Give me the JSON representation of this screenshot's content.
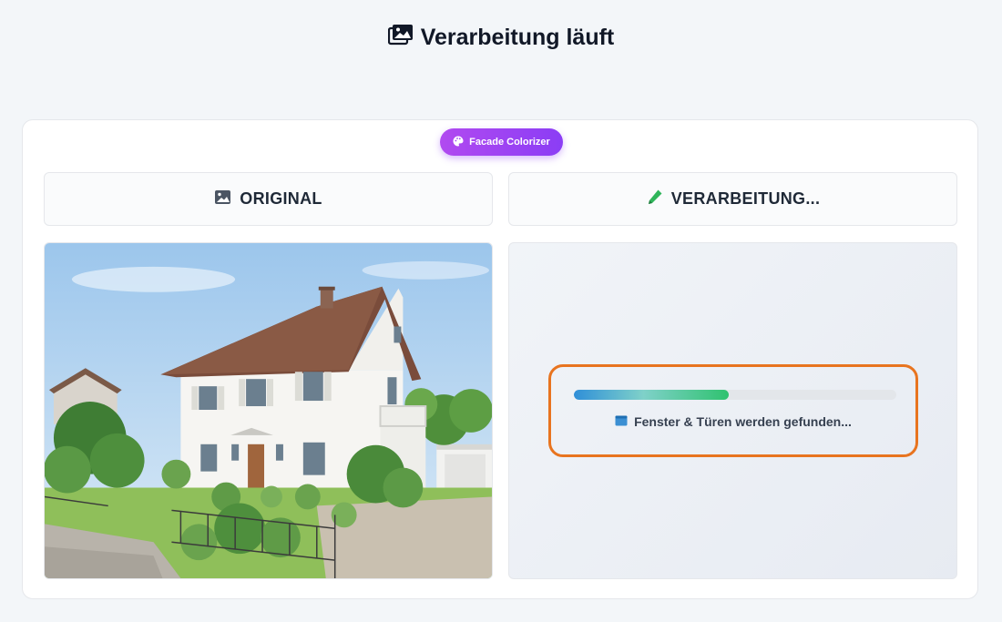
{
  "header": {
    "title": "Verarbeitung läuft",
    "icon": "images-icon"
  },
  "badge": {
    "label": "Facade Colorizer",
    "icon": "palette-icon",
    "color": "#a044f3"
  },
  "panels": {
    "original": {
      "label": "ORIGINAL",
      "icon": "image-icon"
    },
    "processing": {
      "label": "VERARBEITUNG...",
      "icon": "pencil-icon"
    }
  },
  "progress": {
    "fraction": 0.48,
    "status_text": "Fenster & Türen werden gefunden...",
    "status_icon": "window-icon",
    "highlight_color": "#e8741f"
  }
}
